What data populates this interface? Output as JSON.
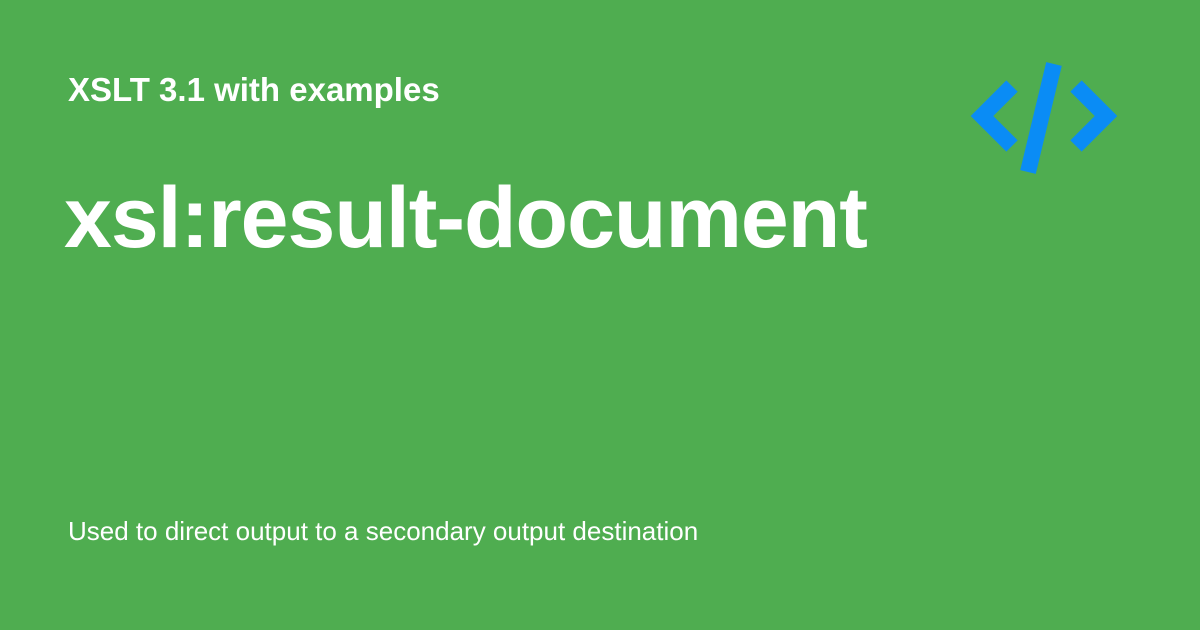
{
  "header": {
    "series_title": "XSLT 3.1 with examples"
  },
  "main": {
    "title": "xsl:result-document",
    "description": "Used to direct output to a secondary output destination"
  },
  "icons": {
    "logo": "code-brackets-icon"
  },
  "colors": {
    "background": "#4fad50",
    "text": "#ffffff",
    "icon": "#0a8cf5"
  }
}
